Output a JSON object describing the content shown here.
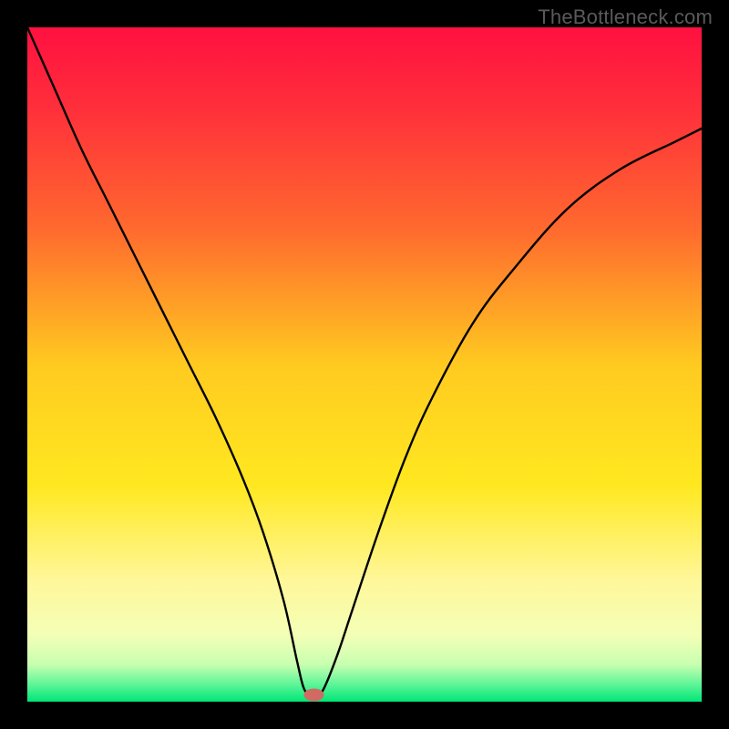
{
  "watermark": "TheBottleneck.com",
  "chart_data": {
    "type": "line",
    "title": "",
    "xlabel": "",
    "ylabel": "",
    "xlim": [
      0,
      100
    ],
    "ylim": [
      0,
      100
    ],
    "annotations": [],
    "gradient_stops": [
      {
        "offset": 0.0,
        "color": "#ff1040"
      },
      {
        "offset": 0.12,
        "color": "#ff2f3b"
      },
      {
        "offset": 0.3,
        "color": "#ff6a2e"
      },
      {
        "offset": 0.5,
        "color": "#ffca20"
      },
      {
        "offset": 0.68,
        "color": "#ffe820"
      },
      {
        "offset": 0.82,
        "color": "#fff79a"
      },
      {
        "offset": 0.9,
        "color": "#f4ffb6"
      },
      {
        "offset": 0.945,
        "color": "#c8ffb0"
      },
      {
        "offset": 0.975,
        "color": "#5cf598"
      },
      {
        "offset": 1.0,
        "color": "#00e676"
      }
    ],
    "series": [
      {
        "name": "bottleneck-curve",
        "x": [
          0,
          4,
          8,
          12,
          16,
          20,
          24,
          28,
          32,
          35,
          38,
          40,
          41,
          42,
          43,
          44,
          46,
          48,
          52,
          56,
          60,
          66,
          72,
          80,
          88,
          96,
          100
        ],
        "y": [
          100,
          91,
          82,
          74,
          66,
          58,
          50,
          42,
          33,
          25,
          15,
          6,
          2,
          1,
          1,
          2,
          7,
          13,
          25,
          36,
          45,
          56,
          64,
          73,
          79,
          83,
          85
        ]
      }
    ],
    "marker": {
      "x": 42.5,
      "y": 1.0,
      "color": "#d06a63",
      "rx": 11,
      "ry": 7
    }
  }
}
